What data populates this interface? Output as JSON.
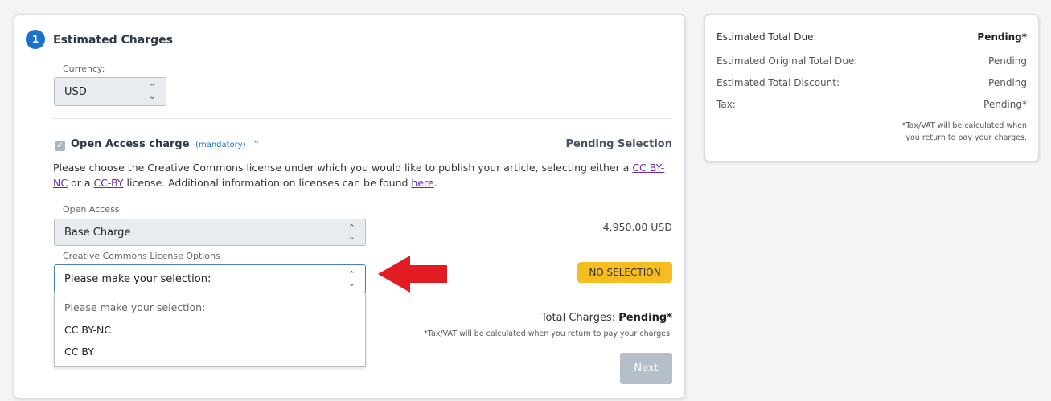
{
  "estimated_charges": {
    "step_number": "1",
    "title": "Estimated Charges",
    "currency": {
      "label": "Currency:",
      "value": "USD"
    },
    "open_access_charge": {
      "title": "Open Access charge",
      "mandatory": "(mandatory)",
      "status": "Pending Selection",
      "description_prefix": "Please choose the Creative Commons license under which you would like to publish your article, selecting either a ",
      "link_ccbync": "CC BY-NC",
      "description_mid": " or a ",
      "link_ccby": "CC-BY",
      "description_suffix": " license. Additional information on licenses can be found ",
      "link_here": "here",
      "description_end": "."
    },
    "open_access": {
      "label": "Open Access",
      "value": "Base Charge",
      "price": "4,950.00 USD"
    },
    "license_options": {
      "label": "Creative Commons License Options",
      "value": "Please make your selection:",
      "badge": "NO SELECTION",
      "options": [
        "Please make your selection:",
        "CC BY-NC",
        "CC BY"
      ]
    },
    "total": {
      "label": "Total Charges:",
      "value": "Pending*"
    },
    "tax_note": "*Tax/VAT will be calculated when you return to pay your charges.",
    "next_label": "Next"
  },
  "summary": {
    "rows": [
      {
        "label": "Estimated Total Due:",
        "value": "Pending*"
      },
      {
        "label": "Estimated Original Total Due:",
        "value": "Pending"
      },
      {
        "label": "Estimated Total Discount:",
        "value": "Pending"
      },
      {
        "label": "Tax:",
        "value": "Pending*"
      }
    ],
    "note_line1": "*Tax/VAT will be calculated when",
    "note_line2": "you return to pay your charges."
  },
  "colors": {
    "accent": "#1a73c8",
    "badge": "#f5bd1f",
    "arrow": "#e31b23",
    "link": "#6a2aa8"
  }
}
